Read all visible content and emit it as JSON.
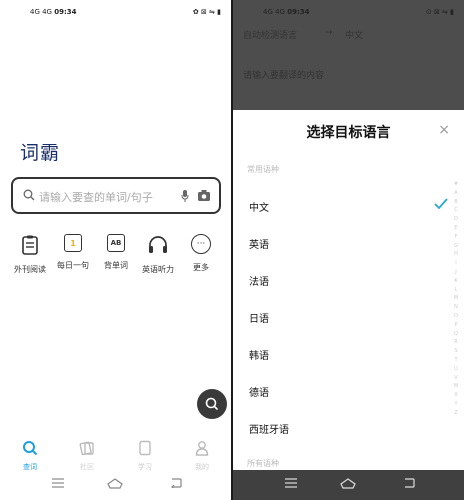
{
  "left_screen": {
    "status_bar": {
      "signal": "4G 4G",
      "time": "09:34",
      "indicators": "✿ ⊠ ⇋ ▮"
    },
    "brand": "词霸",
    "search": {
      "placeholder": "请输入要查的单词/句子"
    },
    "features": [
      {
        "label": "外刊阅读",
        "icon": "clipboard-icon"
      },
      {
        "label": "每日一句",
        "icon": "calendar-one-icon",
        "badge": "1"
      },
      {
        "label": "背单词",
        "icon": "ab-card-icon",
        "badge": "AB"
      },
      {
        "label": "英语听力",
        "icon": "headphones-icon"
      },
      {
        "label": "更多",
        "icon": "more-dots-icon",
        "badge": "···"
      }
    ],
    "tabs": [
      {
        "label": "查词",
        "icon": "search-icon",
        "active": true
      },
      {
        "label": "社区",
        "icon": "cards-icon",
        "active": false
      },
      {
        "label": "学习",
        "icon": "book-icon",
        "active": false
      },
      {
        "label": "我的",
        "icon": "user-icon",
        "active": false
      }
    ]
  },
  "right_screen": {
    "status_bar": {
      "signal": "4G 4G",
      "time": "09:34",
      "indicators": "⊙ ⊠ ⇋ ▮"
    },
    "background": {
      "source_language": "自动检测语言",
      "arrow": "→",
      "target_language": "中文",
      "hint": "请输入要翻译的内容"
    },
    "sheet": {
      "title": "选择目标语言",
      "close": "×",
      "common_section": "常用语种",
      "languages": [
        "中文",
        "英语",
        "法语",
        "日语",
        "韩语",
        "德语",
        "西班牙语"
      ],
      "selected": "中文",
      "all_section": "所有语种",
      "alphabet": [
        "#",
        "A",
        "B",
        "C",
        "D",
        "E",
        "F",
        "G",
        "H",
        "I",
        "J",
        "K",
        "L",
        "M",
        "N",
        "O",
        "P",
        "Q",
        "R",
        "S",
        "T",
        "U",
        "V",
        "W",
        "X",
        "Y",
        "Z"
      ]
    }
  },
  "colors": {
    "accent": "#1e9fe0",
    "check": "#2aa9c9",
    "brand": "#1a2f6a",
    "overlay": "#4d4d4d",
    "fab": "#3a3a3a"
  }
}
